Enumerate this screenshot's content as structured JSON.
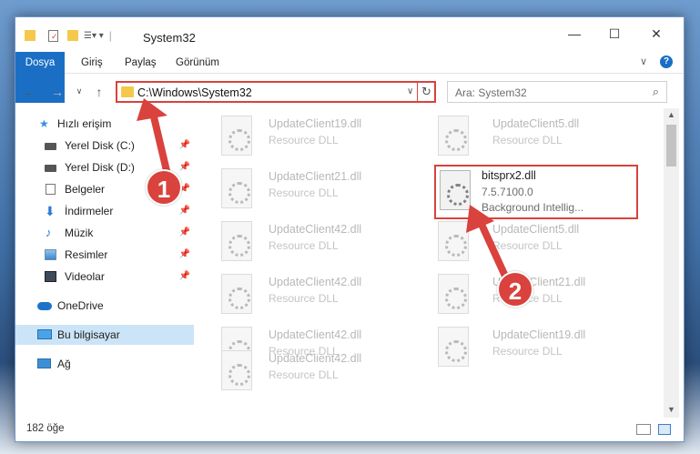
{
  "window": {
    "title": "System32",
    "controls": {
      "minimize": "—",
      "maximize": "☐",
      "close": "✕"
    }
  },
  "ribbon": {
    "tabs": [
      "Dosya",
      "Giriş",
      "Paylaş",
      "Görünüm"
    ]
  },
  "navigation": {
    "address": "C:\\Windows\\System32",
    "search_placeholder": "Ara: System32"
  },
  "sidebar": {
    "items": [
      {
        "label": "Hızlı erişim",
        "icon": "star-icon"
      },
      {
        "label": "Yerel Disk (C:)",
        "icon": "drive-icon",
        "pinned": true
      },
      {
        "label": "Yerel Disk (D:)",
        "icon": "drive-icon",
        "pinned": true
      },
      {
        "label": "Belgeler",
        "icon": "documents-icon",
        "pinned": true
      },
      {
        "label": "İndirmeler",
        "icon": "download-icon",
        "pinned": true
      },
      {
        "label": "Müzik",
        "icon": "music-icon",
        "pinned": true
      },
      {
        "label": "Resimler",
        "icon": "pictures-icon",
        "pinned": true
      },
      {
        "label": "Videolar",
        "icon": "videos-icon",
        "pinned": true
      },
      {
        "label": "OneDrive",
        "icon": "cloud-icon"
      },
      {
        "label": "Bu bilgisayar",
        "icon": "computer-icon",
        "selected": true
      },
      {
        "label": "Ağ",
        "icon": "network-icon"
      }
    ]
  },
  "files": {
    "left": [
      {
        "name": "UpdateClient19.dll",
        "sub": "Resource DLL"
      },
      {
        "name": "UpdateClient21.dll",
        "sub": "Resource DLL"
      },
      {
        "name": "UpdateClient42.dll",
        "sub": "Resource DLL"
      },
      {
        "name": "UpdateClient42.dll",
        "sub": "Resource DLL"
      },
      {
        "name": "UpdateClient42.dll",
        "sub": "Resource DLL"
      },
      {
        "name": "UpdateClient42.dll",
        "sub": "Resource DLL"
      }
    ],
    "right": [
      {
        "name": "UpdateClient5.dll",
        "sub": "Resource DLL"
      },
      {
        "name": "bitsprx2.dll",
        "sub": "7.5.7100.0",
        "sub2": "Background Intellig...",
        "highlighted": true
      },
      {
        "name": "UpdateClient5.dll",
        "sub": "Resource DLL"
      },
      {
        "name": "UpdateClient21.dll",
        "sub": "Resource DLL"
      },
      {
        "name": "UpdateClient19.dll",
        "sub": "Resource DLL"
      }
    ]
  },
  "status": {
    "item_count": "182 öğe"
  },
  "annotations": {
    "step1": "1",
    "step2": "2",
    "color": "#d9423d"
  }
}
